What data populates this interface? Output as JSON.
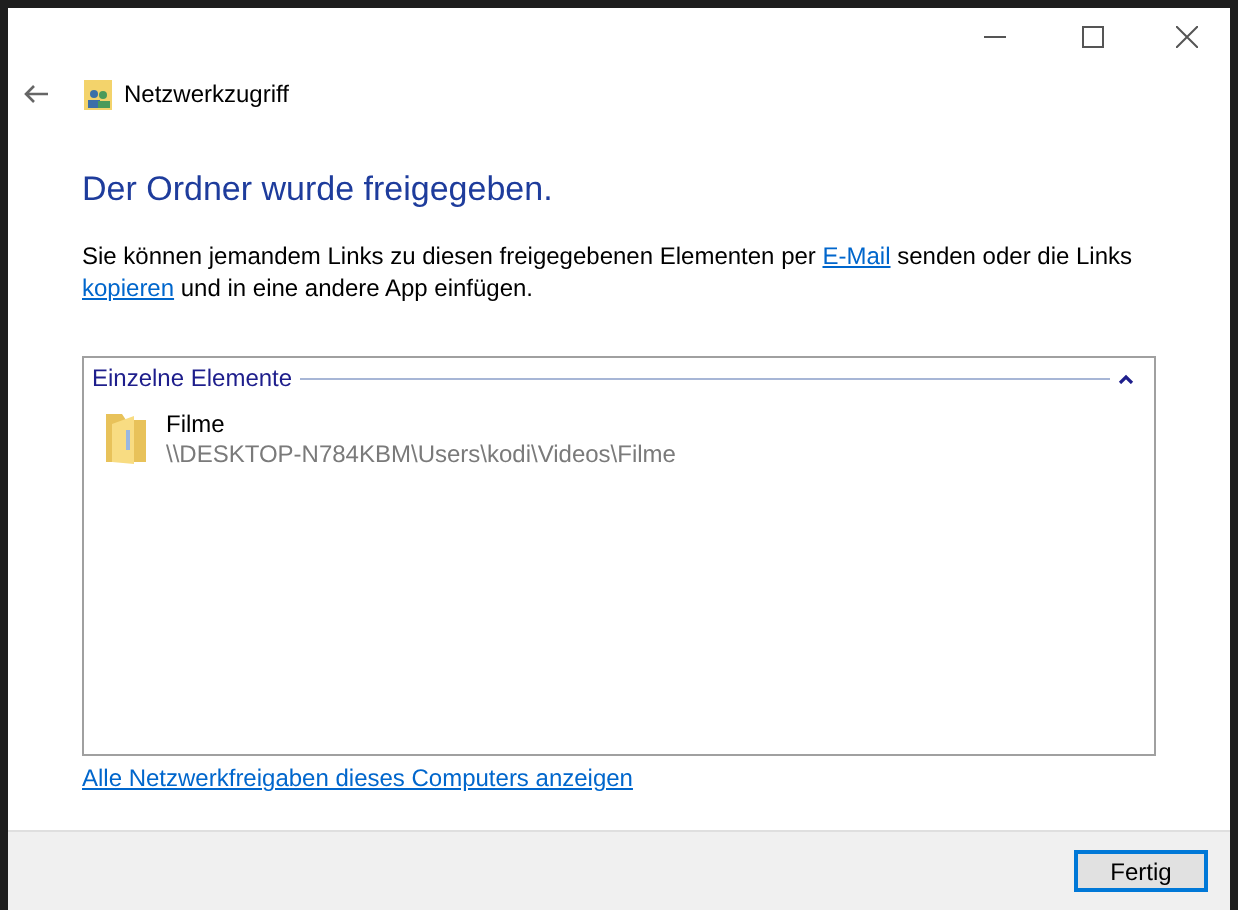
{
  "window": {
    "title": "Netzwerkzugriff"
  },
  "heading": "Der Ordner wurde freigegeben.",
  "description": [
    {
      "kind": "text",
      "text": "Sie können jemandem Links zu diesen freigegebenen Elementen per "
    },
    {
      "kind": "link",
      "text": "E-Mail"
    },
    {
      "kind": "text",
      "text": " senden oder die Links "
    },
    {
      "kind": "link",
      "text": "kopieren"
    },
    {
      "kind": "text",
      "text": " und in eine andere App einfügen."
    }
  ],
  "group": {
    "title": "Einzelne Elemente",
    "expanded": true,
    "items": [
      {
        "name": "Filme",
        "path": "\\\\DESKTOP-N784KBM\\Users\\kodi\\Videos\\Filme"
      }
    ]
  },
  "shares_link": "Alle Netzwerkfreigaben dieses Computers anzeigen",
  "buttons": [
    "Fertig"
  ]
}
